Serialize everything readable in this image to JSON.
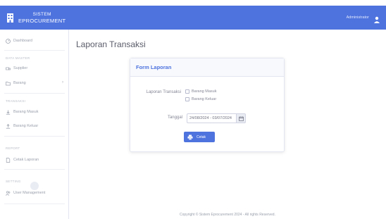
{
  "app": {
    "brand_line1": "SISTEM",
    "brand_line2": "EPROCUREMENT",
    "user_name": "Administrator"
  },
  "sidebar": {
    "dashboard": "Dashboard",
    "section_master": "DATA MASTER",
    "supplier": "Supplier",
    "barang": "Barang",
    "section_transaksi": "TRANSAKSI",
    "barang_masuk": "Barang Masuk",
    "barang_keluar": "Barang Keluar",
    "section_report": "REPORT",
    "cetak_laporan": "Cetak Laporan",
    "section_setting": "SETTING",
    "user_management": "User Management"
  },
  "main": {
    "page_title": "Laporan Transaksi",
    "card_title": "Form Laporan",
    "label_transaksi": "Laporan Transaksi",
    "option_masuk": "Barang Masuk",
    "option_keluar": "Barang Keluar",
    "label_tanggal": "Tanggal",
    "date_range": "24/08/2024 - 03/07/2024",
    "print_label": "Cetak"
  },
  "footer": {
    "text": "Copyright © Sistem Eprocurement 2024 - All rights Reserved."
  },
  "colors": {
    "primary": "#4e73df",
    "text_muted": "#858796"
  },
  "icons": {
    "brand": "building-icon",
    "user": "user-avatar-icon",
    "dashboard": "gauge-icon",
    "supplier": "truck-icon",
    "barang": "folder-icon",
    "barang_masuk": "download-icon",
    "barang_keluar": "upload-icon",
    "cetak_laporan": "file-icon",
    "user_management": "users-icon",
    "calendar": "calendar-icon",
    "print": "print-icon"
  }
}
